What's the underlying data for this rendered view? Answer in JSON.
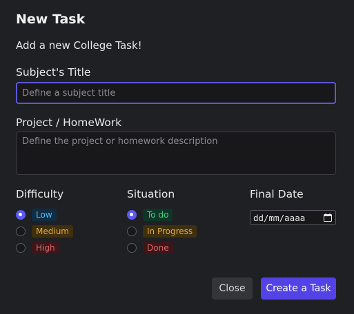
{
  "dialog": {
    "title": "New Task",
    "subtitle": "Add a new College Task!"
  },
  "subject": {
    "label": "Subject's Title",
    "placeholder": "Define a subject title",
    "value": ""
  },
  "project": {
    "label": "Project / HomeWork",
    "placeholder": "Define the project or homework description",
    "value": ""
  },
  "difficulty": {
    "label": "Difficulty",
    "options": [
      {
        "label": "Low",
        "selected": true,
        "color": "#5fb8ea"
      },
      {
        "label": "Medium",
        "selected": false,
        "color": "#e0ad3a"
      },
      {
        "label": "High",
        "selected": false,
        "color": "#e06a6a"
      }
    ]
  },
  "situation": {
    "label": "Situation",
    "options": [
      {
        "label": "To do",
        "selected": true,
        "color": "#3ed28a"
      },
      {
        "label": "In Progress",
        "selected": false,
        "color": "#e0ad3a"
      },
      {
        "label": "Done",
        "selected": false,
        "color": "#e06a6a"
      }
    ]
  },
  "final_date": {
    "label": "Final Date",
    "placeholder": "dd/mm/aaaa",
    "icon": "calendar-icon"
  },
  "buttons": {
    "close": "Close",
    "create": "Create a Task"
  },
  "colors": {
    "accent": "#5343e6",
    "radio_checked": "#5b5bf0",
    "background": "#1f2024"
  }
}
